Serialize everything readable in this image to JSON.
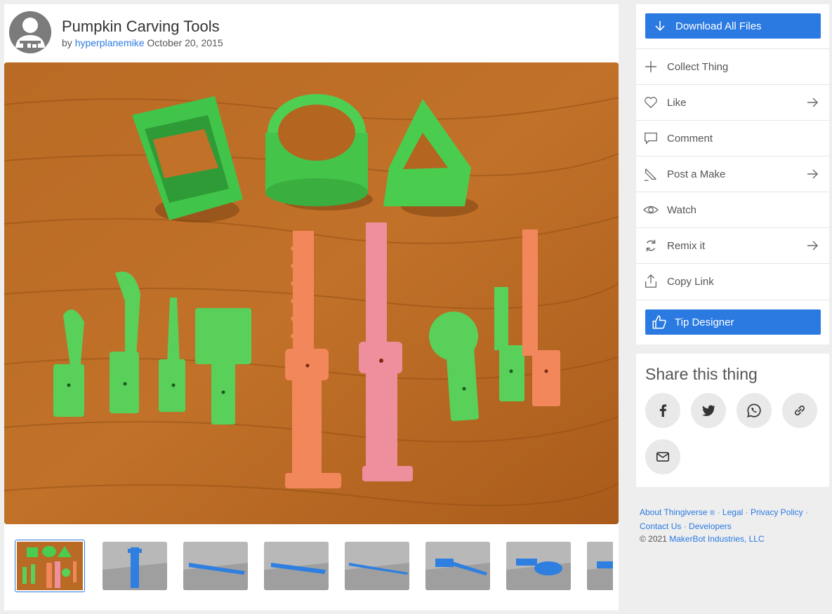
{
  "thing": {
    "title": "Pumpkin Carving Tools",
    "by_prefix": "by",
    "author": "hyperplanemike",
    "date": "October 20, 2015"
  },
  "images": {
    "hero_icon": "photo-of-green-and-orange-3d-printed-tools",
    "thumbnails": [
      "photo",
      "render-blue-handle",
      "render-blue-blade",
      "render-blue-blade-2",
      "render-blue-thin-blade",
      "render-blue-scoop",
      "render-blue-wheel",
      "render-blue-partial"
    ]
  },
  "actions": {
    "download": "Download All Files",
    "collect": "Collect Thing",
    "like": "Like",
    "comment": "Comment",
    "post_make": "Post a Make",
    "watch": "Watch",
    "remix": "Remix it",
    "copy_link": "Copy Link",
    "tip": "Tip Designer"
  },
  "share": {
    "title": "Share this thing",
    "buttons": [
      "facebook-icon",
      "twitter-icon",
      "whatsapp-icon",
      "link-icon",
      "email-icon"
    ]
  },
  "footer": {
    "about": "About Thingiverse",
    "reg": "®",
    "legal": "Legal",
    "privacy": "Privacy Policy",
    "contact": "Contact Us",
    "developers": "Developers",
    "copyright_prefix": "©  2021",
    "company": "MakerBot Industries, LLC",
    "dot": "·"
  },
  "colors": {
    "accent": "#2a7ae2",
    "wood": "#b5651e",
    "green_plastic": "#55d356",
    "orange_plastic": "#f2875c",
    "pink_plastic": "#ef8e9d",
    "blue_render": "#2e7fe0"
  }
}
